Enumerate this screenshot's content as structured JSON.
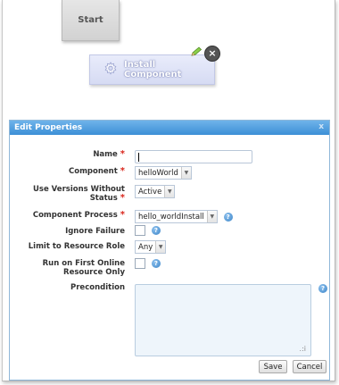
{
  "canvas": {
    "start_node_label": "Start",
    "install_node_label": "Install Component",
    "icons": [
      "gear-icon",
      "pencil-icon",
      "close-icon"
    ]
  },
  "dialog": {
    "title": "Edit Properties",
    "close_label": "x",
    "fields": {
      "name": {
        "label": "Name",
        "required": "*",
        "value": ""
      },
      "component": {
        "label": "Component",
        "required": "*",
        "value": "helloWorld"
      },
      "use_versions": {
        "label_line1": "Use Versions Without",
        "label_line2": "Status",
        "required": "*",
        "value": "Active"
      },
      "component_process": {
        "label": "Component Process",
        "required": "*",
        "value": "hello_worldInstall"
      },
      "ignore_failure": {
        "label": "Ignore Failure",
        "checked": false
      },
      "limit_resource_role": {
        "label": "Limit to Resource Role",
        "value": "Any"
      },
      "run_first_online": {
        "label_line1": "Run on First Online",
        "label_line2": "Resource Only",
        "checked": false
      },
      "precondition": {
        "label": "Precondition",
        "value": ""
      }
    },
    "buttons": {
      "save": "Save",
      "cancel": "Cancel"
    },
    "colors": {
      "header": "#3c8fd6",
      "required": "#d9261c",
      "textarea_bg": "#eef5fb"
    }
  }
}
